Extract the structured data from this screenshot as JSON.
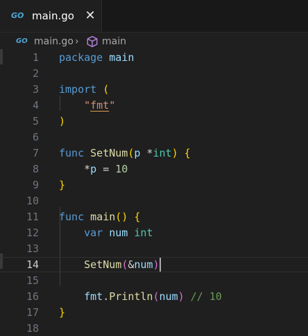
{
  "tab": {
    "label": "main.go",
    "icon": "go-file-icon",
    "logo_text": "GO",
    "close_glyph": "✕"
  },
  "breadcrumb": {
    "file": "main.go",
    "separator": "›",
    "symbol": "main"
  },
  "editor": {
    "active_line": 14,
    "lines": [
      {
        "n": "1",
        "tokens": [
          [
            "kw",
            "package"
          ],
          [
            "plain",
            " "
          ],
          [
            "ident",
            "main"
          ]
        ]
      },
      {
        "n": "2",
        "tokens": []
      },
      {
        "n": "3",
        "tokens": [
          [
            "kw",
            "import"
          ],
          [
            "plain",
            " "
          ],
          [
            "b1",
            "("
          ]
        ]
      },
      {
        "n": "4",
        "tokens": [
          [
            "plain",
            "    "
          ],
          [
            "str",
            "\""
          ],
          [
            "str squiggle",
            "fmt"
          ],
          [
            "str",
            "\""
          ]
        ]
      },
      {
        "n": "5",
        "tokens": [
          [
            "b1",
            ")"
          ]
        ]
      },
      {
        "n": "6",
        "tokens": []
      },
      {
        "n": "7",
        "tokens": [
          [
            "kw",
            "func"
          ],
          [
            "plain",
            " "
          ],
          [
            "fn",
            "SetNum"
          ],
          [
            "b1",
            "("
          ],
          [
            "ident",
            "p"
          ],
          [
            "plain",
            " *"
          ],
          [
            "type",
            "int"
          ],
          [
            "b1",
            ")"
          ],
          [
            "plain",
            " "
          ],
          [
            "b1",
            "{"
          ]
        ]
      },
      {
        "n": "8",
        "tokens": [
          [
            "plain",
            "    *"
          ],
          [
            "ident",
            "p"
          ],
          [
            "plain",
            " = "
          ],
          [
            "num",
            "10"
          ]
        ]
      },
      {
        "n": "9",
        "tokens": [
          [
            "b1",
            "}"
          ]
        ]
      },
      {
        "n": "10",
        "tokens": []
      },
      {
        "n": "11",
        "tokens": [
          [
            "kw",
            "func"
          ],
          [
            "plain",
            " "
          ],
          [
            "fn",
            "main"
          ],
          [
            "b1",
            "()"
          ],
          [
            "plain",
            " "
          ],
          [
            "b1",
            "{"
          ]
        ]
      },
      {
        "n": "12",
        "tokens": [
          [
            "plain",
            "    "
          ],
          [
            "kw",
            "var"
          ],
          [
            "plain",
            " "
          ],
          [
            "ident",
            "num"
          ],
          [
            "plain",
            " "
          ],
          [
            "type",
            "int"
          ]
        ]
      },
      {
        "n": "13",
        "tokens": []
      },
      {
        "n": "14",
        "tokens": [
          [
            "plain",
            "    "
          ],
          [
            "fn",
            "SetNum"
          ],
          [
            "b2",
            "("
          ],
          [
            "plain",
            "&"
          ],
          [
            "ident",
            "num"
          ],
          [
            "b2",
            ")"
          ]
        ]
      },
      {
        "n": "15",
        "tokens": []
      },
      {
        "n": "16",
        "tokens": [
          [
            "plain",
            "    "
          ],
          [
            "ident",
            "fmt"
          ],
          [
            "plain",
            "."
          ],
          [
            "fn",
            "Println"
          ],
          [
            "b2",
            "("
          ],
          [
            "ident",
            "num"
          ],
          [
            "b2",
            ")"
          ],
          [
            "plain",
            " "
          ],
          [
            "cmt",
            "// 10"
          ]
        ]
      },
      {
        "n": "17",
        "tokens": [
          [
            "b1",
            "}"
          ]
        ]
      },
      {
        "n": "18",
        "tokens": []
      }
    ]
  },
  "colors": {
    "background": "#1f1f1f",
    "keyword": "#569cd6",
    "function": "#dcdcaa",
    "type": "#4ec9b0",
    "string": "#ce9178",
    "number": "#b5cea8",
    "comment": "#6a9955",
    "bracket_level1": "#ffd700",
    "bracket_level2": "#da70d6"
  }
}
